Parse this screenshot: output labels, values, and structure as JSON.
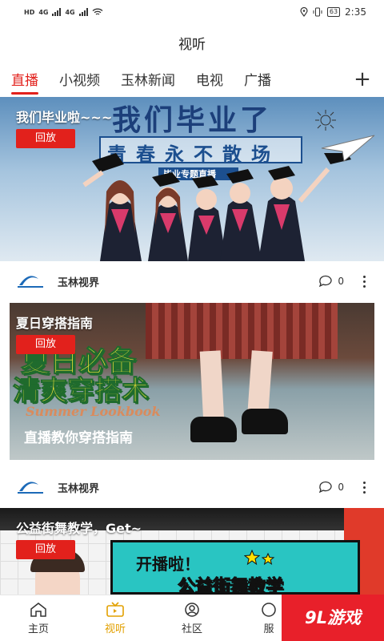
{
  "status": {
    "network_left": "HD",
    "sig1_label": "4G",
    "sig2_label": "4G",
    "battery": "63",
    "time": "2:35"
  },
  "title": "视听",
  "tabs": [
    "直播",
    "小视频",
    "玉林新闻",
    "电视",
    "广播"
  ],
  "cards": [
    {
      "title": "我们毕业啦~~~",
      "badge": "回放",
      "hero_line1": "我们毕业了",
      "hero_line2": "青春永不散场",
      "hero_line3": "毕业专题直播",
      "channel": "玉林视界",
      "comments": "0"
    },
    {
      "title": "夏日穿搭指南",
      "badge": "回放",
      "hero_line1": "夏日必备",
      "hero_line2": "清爽穿搭术",
      "hero_line3": "Summer Lookbook",
      "hero_line4": "直播教你穿搭指南",
      "channel": "玉林视界",
      "comments": "0"
    },
    {
      "title": "公益街舞教学，Get~",
      "badge": "回放",
      "hero_line1": "开播啦！",
      "hero_line2": "公益街舞教学"
    }
  ],
  "nav": [
    "主页",
    "视听",
    "社区",
    "服"
  ],
  "watermark": "9L游戏",
  "colors": {
    "accent": "#e2211c",
    "nav_active": "#e2a000"
  }
}
